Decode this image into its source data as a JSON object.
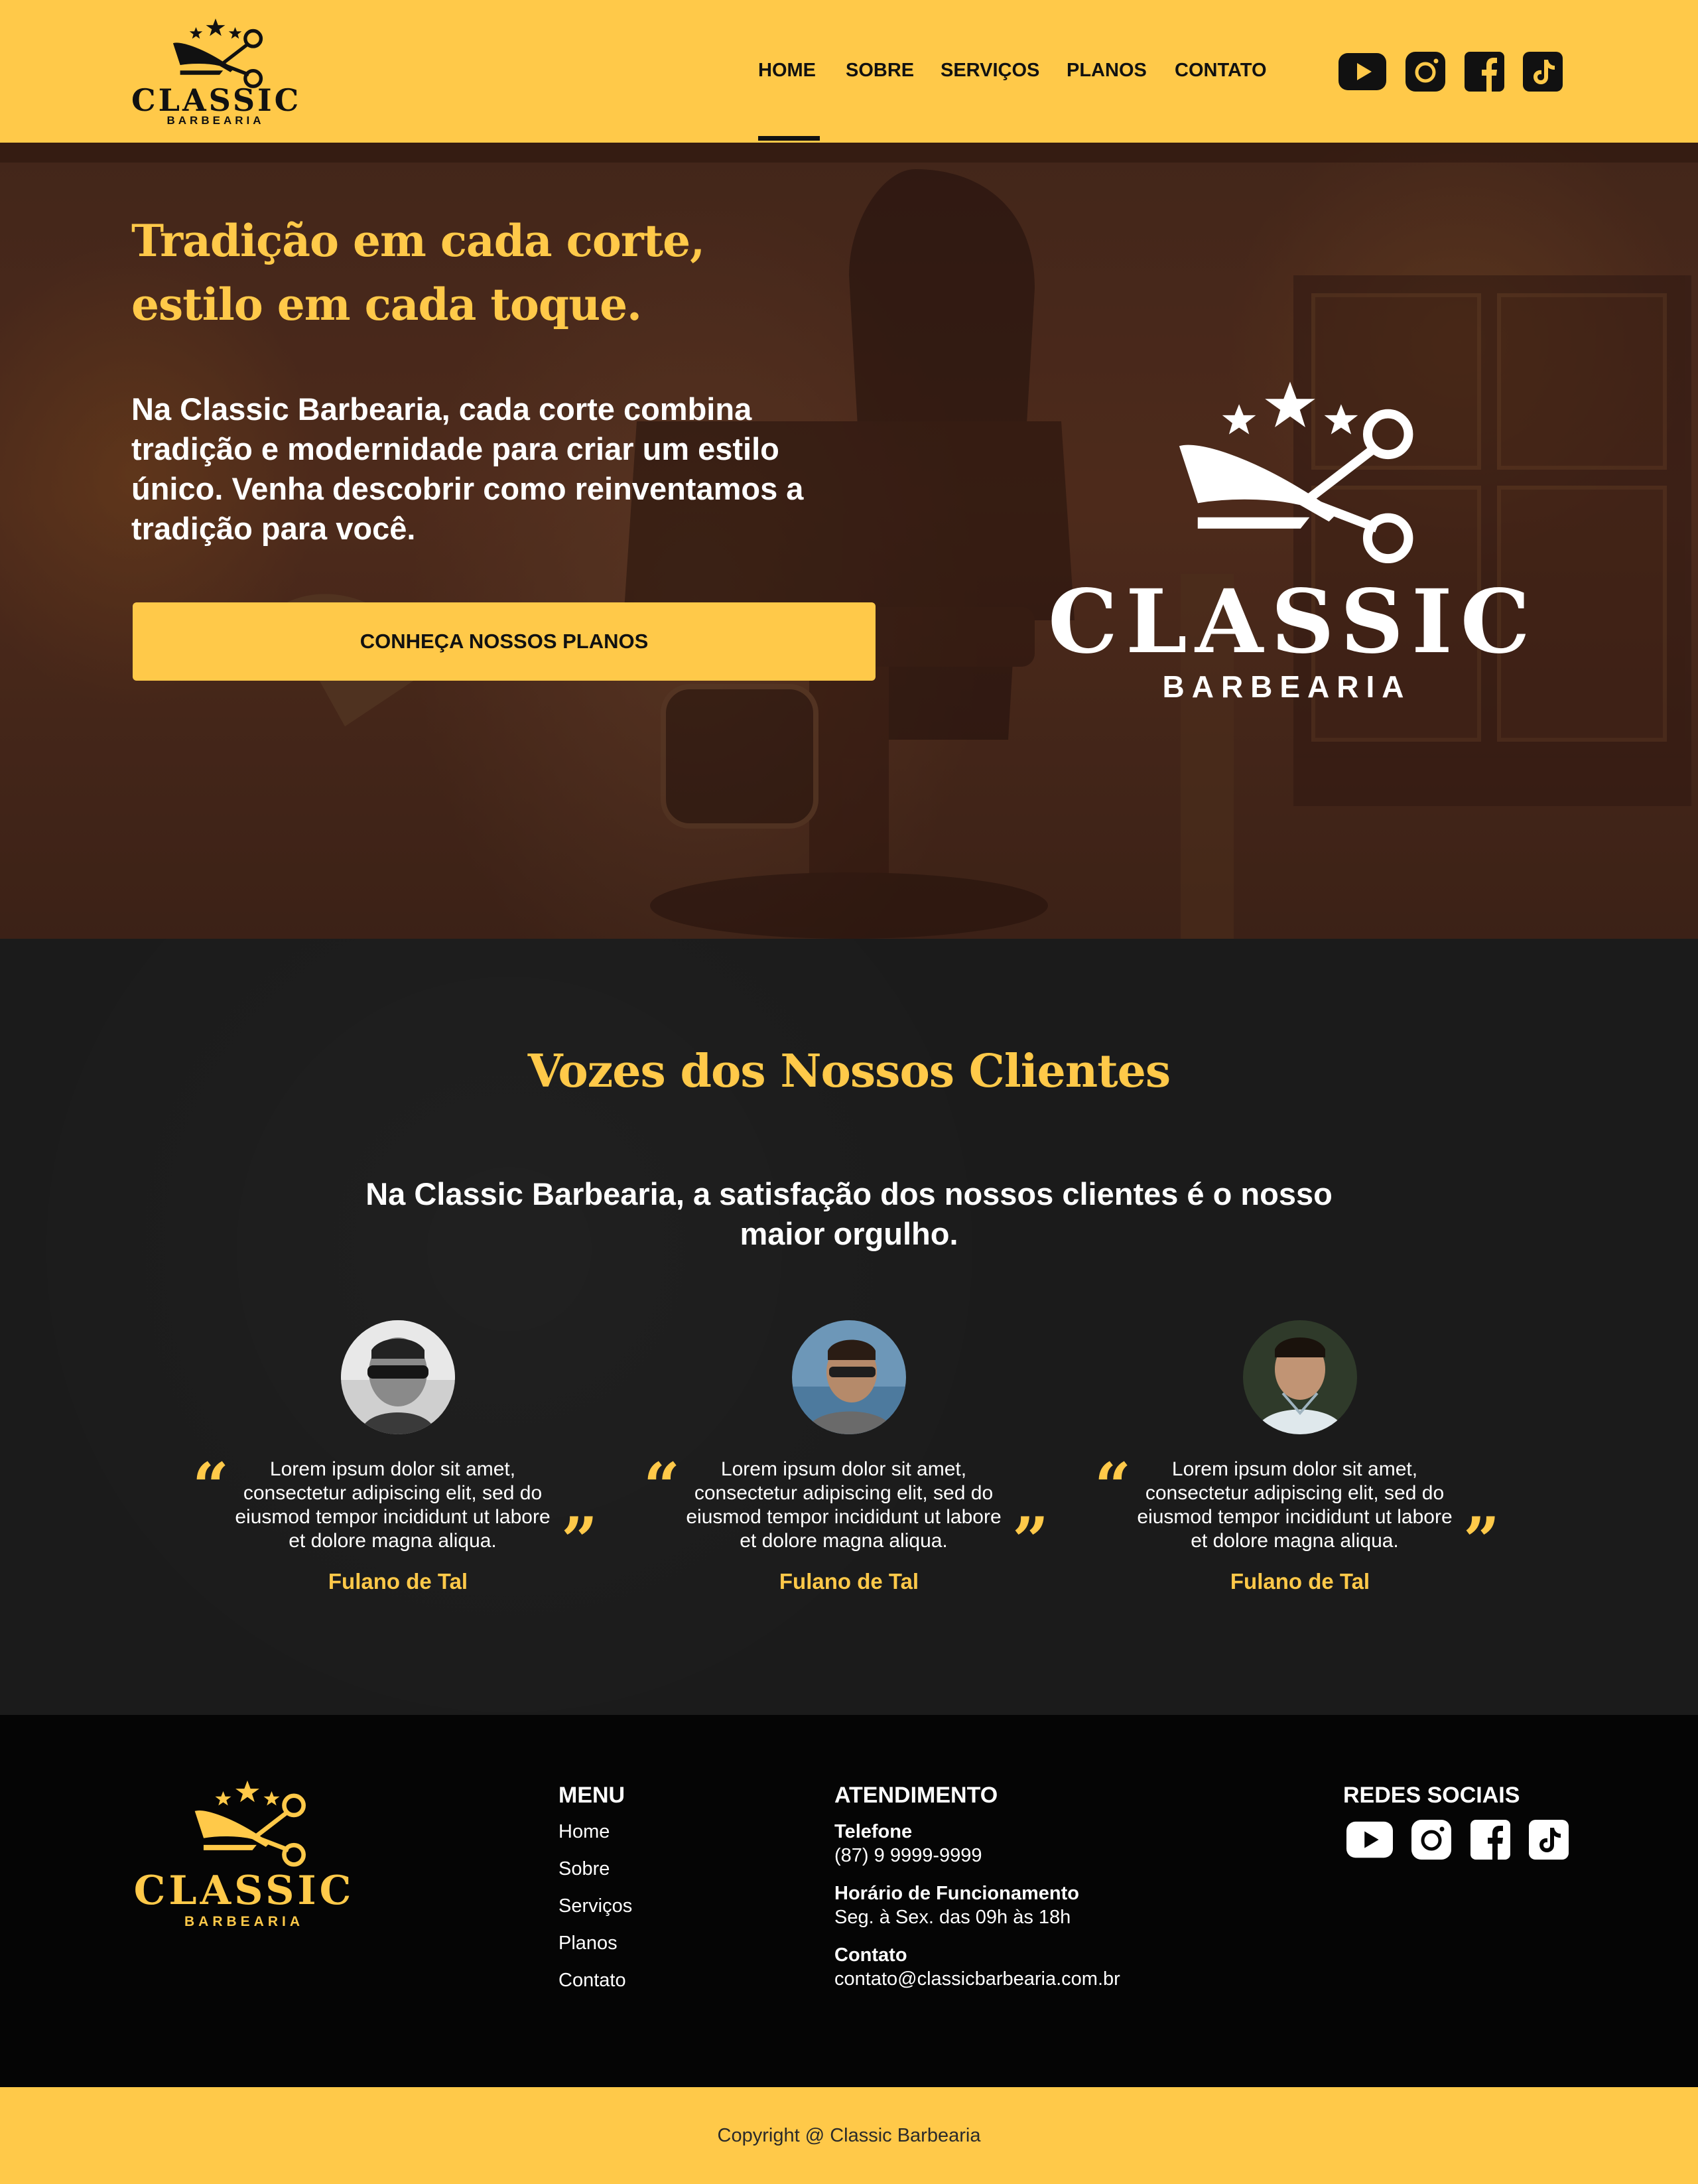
{
  "colors": {
    "accent": "#ffc949",
    "dark": "#1b1b1b",
    "footer": "#050505",
    "text": "#ffffff"
  },
  "brand": {
    "name": "CLASSIC",
    "tagline": "BARBEARIA"
  },
  "nav": {
    "items": [
      "HOME",
      "SOBRE",
      "SERVIÇOS",
      "PLANOS",
      "CONTATO"
    ],
    "active": "HOME"
  },
  "social": [
    "youtube-icon",
    "instagram-icon",
    "facebook-icon",
    "tiktok-icon"
  ],
  "hero": {
    "title_line1": "Tradição em cada corte,",
    "title_line2": "estilo em cada toque.",
    "text": "Na Classic Barbearia, cada corte combina tradição e modernidade para criar um estilo único. Venha descobrir como reinventamos a tradição para você.",
    "cta": "CONHEÇA NOSSOS PLANOS"
  },
  "testimonials": {
    "title": "Vozes dos Nossos Clientes",
    "subtitle": "Na Classic Barbearia, a satisfação dos nossos clientes é o nosso maior orgulho.",
    "items": [
      {
        "quote": "Lorem ipsum dolor sit amet, consectetur adipiscing elit, sed do eiusmod tempor incididunt ut labore et dolore magna aliqua.",
        "author": "Fulano de Tal"
      },
      {
        "quote": "Lorem ipsum dolor sit amet, consectetur adipiscing elit, sed do eiusmod tempor incididunt ut labore et dolore magna aliqua.",
        "author": "Fulano de Tal"
      },
      {
        "quote": "Lorem ipsum dolor sit amet, consectetur adipiscing elit, sed do eiusmod tempor incididunt ut labore et dolore magna aliqua.",
        "author": "Fulano de Tal"
      }
    ]
  },
  "footer": {
    "menu_title": "MENU",
    "menu_links": [
      "Home",
      "Sobre",
      "Serviços",
      "Planos",
      "Contato"
    ],
    "service_title": "ATENDIMENTO",
    "phone_label": "Telefone",
    "phone": "(87) 9 9999-9999",
    "hours_label": "Horário de Funcionamento",
    "hours": "Seg. à Sex. das 09h às 18h",
    "contact_label": "Contato",
    "email": "contato@classicbarbearia.com.br",
    "social_title": "REDES SOCIAIS",
    "copyright": "Copyright @ Classic Barbearia"
  }
}
